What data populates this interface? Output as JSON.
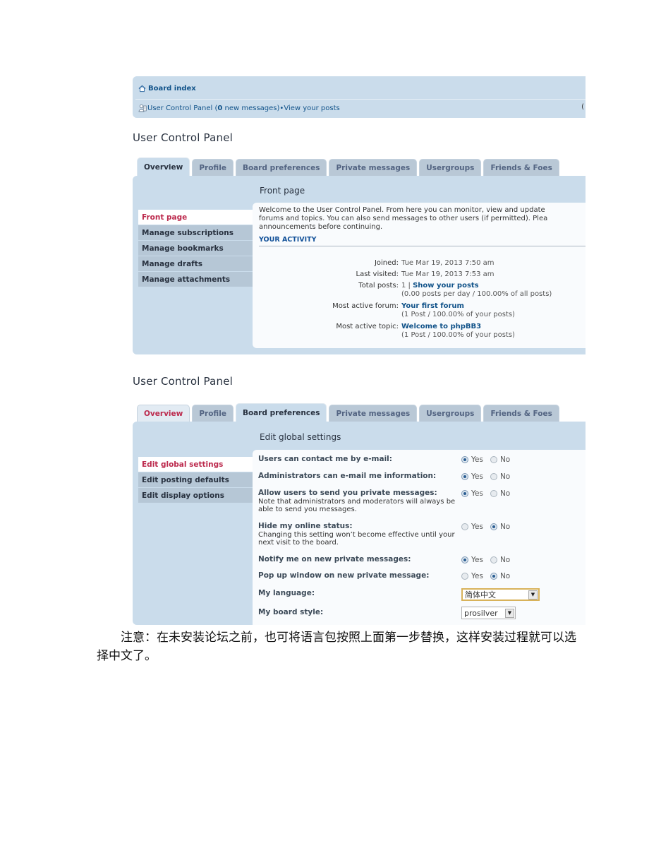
{
  "navbar": {
    "board_index": "Board index",
    "ucp_link": "User Control Panel (",
    "new_count": "0",
    "new_messages_suffix": " new messages)",
    "separator": " • ",
    "view_posts": "View your posts",
    "edge_glyph": "("
  },
  "panel1": {
    "heading": "User Control Panel",
    "tabs": [
      {
        "label": "Overview",
        "state": "active"
      },
      {
        "label": "Profile",
        "state": "inactive"
      },
      {
        "label": "Board preferences",
        "state": "inactive"
      },
      {
        "label": "Private messages",
        "state": "inactive"
      },
      {
        "label": "Usergroups",
        "state": "inactive"
      },
      {
        "label": "Friends & Foes",
        "state": "inactive"
      }
    ],
    "section_title": "Front page",
    "menu": [
      {
        "label": "Front page",
        "active": true
      },
      {
        "label": "Manage subscriptions",
        "active": false
      },
      {
        "label": "Manage bookmarks",
        "active": false
      },
      {
        "label": "Manage drafts",
        "active": false
      },
      {
        "label": "Manage attachments",
        "active": false
      }
    ],
    "welcome_lines": [
      "Welcome to the User Control Panel. From here you can monitor, view and update",
      "forums and topics. You can also send messages to other users (if permitted). Plea",
      "announcements before continuing."
    ],
    "activity_heading": "YOUR ACTIVITY",
    "activity": {
      "joined_label": "Joined:",
      "joined_value": "Tue Mar 19, 2013 7:50 am",
      "last_visited_label": "Last visited:",
      "last_visited_value": "Tue Mar 19, 2013 7:53 am",
      "total_posts_label": "Total posts:",
      "total_posts_value": "1 | ",
      "show_posts_link": "Show your posts",
      "total_posts_detail": "(0.00 posts per day / 100.00% of all posts)",
      "active_forum_label": "Most active forum:",
      "active_forum_link": "Your first forum",
      "active_forum_detail": "(1 Post / 100.00% of your posts)",
      "active_topic_label": "Most active topic:",
      "active_topic_link": "Welcome to phpBB3",
      "active_topic_detail": "(1 Post / 100.00% of your posts)"
    }
  },
  "panel2": {
    "heading": "User Control Panel",
    "tabs": [
      {
        "label": "Overview",
        "state": "visited"
      },
      {
        "label": "Profile",
        "state": "inactive"
      },
      {
        "label": "Board preferences",
        "state": "active"
      },
      {
        "label": "Private messages",
        "state": "inactive"
      },
      {
        "label": "Usergroups",
        "state": "inactive"
      },
      {
        "label": "Friends & Foes",
        "state": "inactive"
      }
    ],
    "section_title": "Edit global settings",
    "menu": [
      {
        "label": "Edit global settings",
        "active": true
      },
      {
        "label": "Edit posting defaults",
        "active": false
      },
      {
        "label": "Edit display options",
        "active": false
      }
    ],
    "settings": [
      {
        "label": "Users can contact me by e-mail:",
        "note": "",
        "value": "Yes"
      },
      {
        "label": "Administrators can e-mail me information:",
        "note": "",
        "value": "Yes"
      },
      {
        "label": "Allow users to send you private messages:",
        "note": "Note that administrators and moderators will always be able to send you messages.",
        "value": "Yes"
      },
      {
        "label": "Hide my online status:",
        "note": "Changing this setting won’t become effective until your next visit to the board.",
        "value": "No"
      },
      {
        "label": "Notify me on new private messages:",
        "note": "",
        "value": "Yes"
      },
      {
        "label": "Pop up window on new private message:",
        "note": "",
        "value": "No"
      }
    ],
    "yes_label": "Yes",
    "no_label": "No",
    "language_label": "My language:",
    "language_value": "简体中文",
    "style_label": "My board style:",
    "style_value": "prosilver"
  },
  "note": {
    "line1": "注意：在未安装论坛之前，也可将语言包按照上面第一步替换，这样安装过程就可以选择中文了。"
  }
}
